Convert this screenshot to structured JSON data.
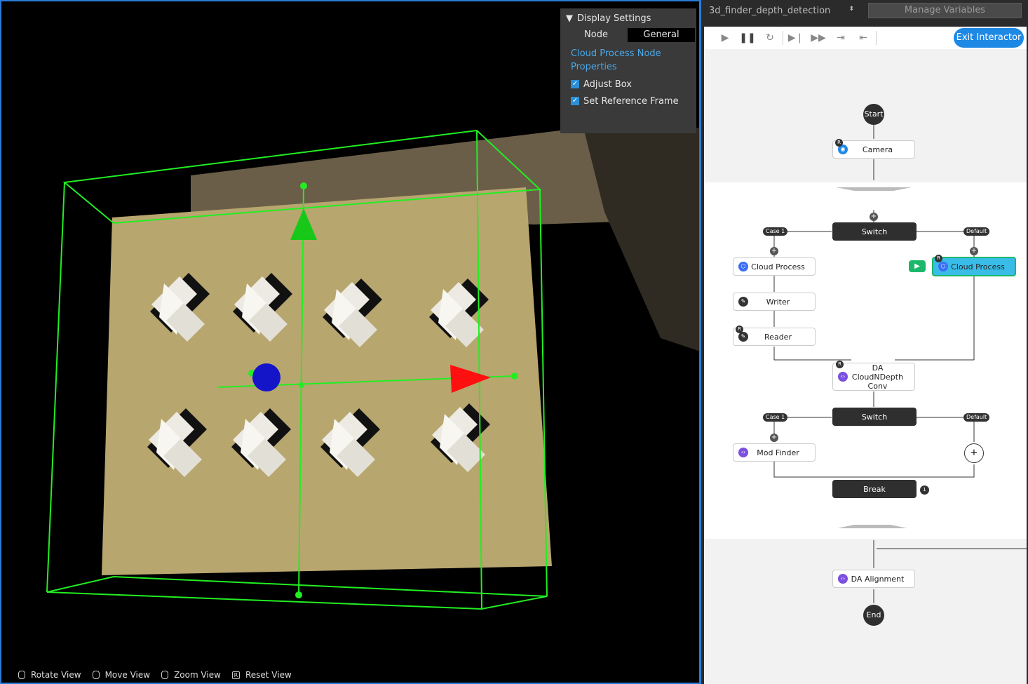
{
  "viewport": {
    "display_settings": {
      "title": "Display Settings",
      "tabs": [
        "Node",
        "General"
      ],
      "active_tab": "General",
      "properties_title": "Cloud Process Node Properties",
      "checkboxes": [
        {
          "label": "Adjust Box",
          "checked": true
        },
        {
          "label": "Set Reference Frame",
          "checked": true
        }
      ]
    },
    "hints": [
      {
        "icon": "mouse-left-icon",
        "label": "Rotate View"
      },
      {
        "icon": "mouse-right-icon",
        "label": "Move View"
      },
      {
        "icon": "mouse-wheel-icon",
        "label": "Zoom View"
      },
      {
        "icon": "r-key-icon",
        "key": "R",
        "label": "Reset View"
      }
    ]
  },
  "right_panel": {
    "project_name": "3d_finder_depth_detection",
    "manage_variables": "Manage Variables",
    "exit_interactor": "Exit Interactor",
    "flow": {
      "start": "Start",
      "end": "End",
      "camera": "Camera",
      "switch1": "Switch",
      "switch2": "Switch",
      "case1": "Case 1",
      "default": "Default",
      "cloud_process_left": "Cloud Process",
      "cloud_process_right": "Cloud Process",
      "writer": "Writer",
      "reader": "Reader",
      "da_conv": "DA CloudNDepth Conv",
      "mod_finder": "Mod Finder",
      "break": "Break",
      "break_count": "1",
      "da_alignment": "DA Alignment",
      "plus": "+",
      "r_badge": "R"
    }
  },
  "colors": {
    "accent": "#1e88e5",
    "bbox": "#22ee22",
    "selected_node": "#39bde8"
  }
}
